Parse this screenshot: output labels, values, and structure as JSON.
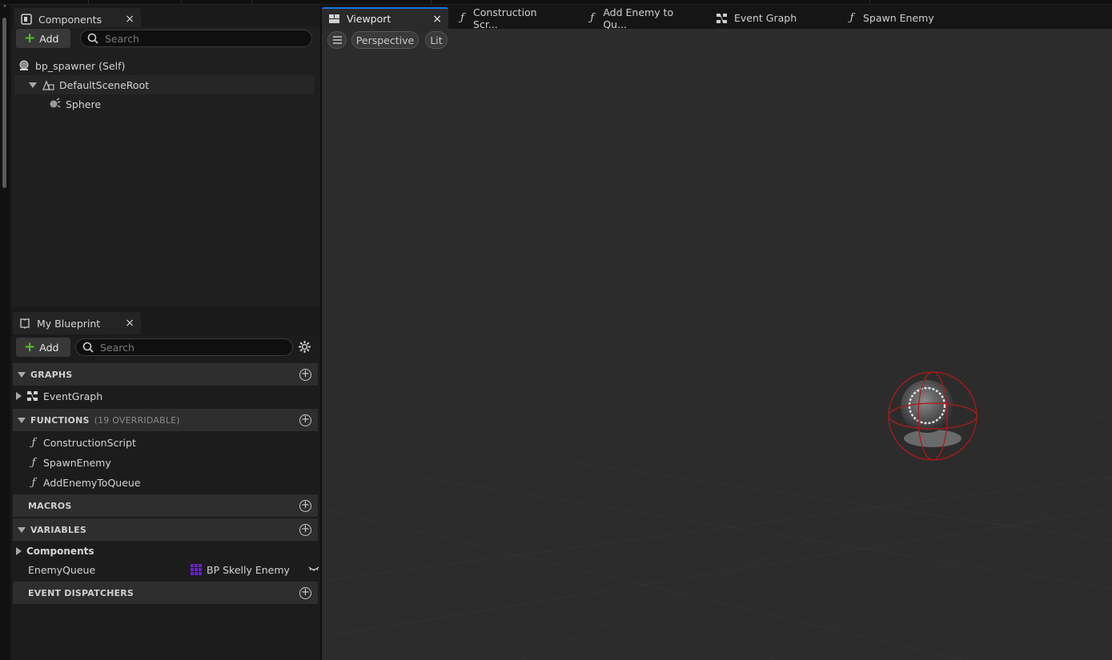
{
  "components_panel": {
    "tab_label": "Components",
    "close_glyph": "×",
    "add_label": "Add",
    "search_placeholder": "Search",
    "tree": [
      {
        "label": "bp_spawner (Self)",
        "icon": "blueprint-self-icon"
      },
      {
        "label": "DefaultSceneRoot",
        "icon": "scene-root-icon"
      },
      {
        "label": "Sphere",
        "icon": "sphere-icon"
      }
    ]
  },
  "my_blueprint_panel": {
    "tab_label": "My Blueprint",
    "close_glyph": "×",
    "add_label": "Add",
    "search_placeholder": "Search",
    "sections": {
      "graphs": {
        "title": "GRAPHS",
        "items": [
          "EventGraph"
        ]
      },
      "functions": {
        "title": "FUNCTIONS",
        "subtitle": "(19 OVERRIDABLE)",
        "items": [
          "ConstructionScript",
          "SpawnEnemy",
          "AddEnemyToQueue"
        ]
      },
      "macros": {
        "title": "MACROS"
      },
      "variables": {
        "title": "VARIABLES",
        "category": "Components",
        "items": [
          {
            "name": "EnemyQueue",
            "type": "BP Skelly Enemy",
            "type_color": "#6a1fd0"
          }
        ]
      },
      "event_dispatchers": {
        "title": "EVENT DISPATCHERS"
      }
    }
  },
  "document_tabs": [
    {
      "label": "Viewport",
      "icon": "viewport-icon",
      "active": true
    },
    {
      "label": "Construction Scr...",
      "icon": "function-icon"
    },
    {
      "label": "Add Enemy to Qu...",
      "icon": "function-icon"
    },
    {
      "label": "Event Graph",
      "icon": "event-graph-icon"
    },
    {
      "label": "Spawn Enemy",
      "icon": "function-icon"
    }
  ],
  "viewport": {
    "view_mode": "Perspective",
    "lighting_mode": "Lit"
  },
  "colors": {
    "accent": "#1a73e8",
    "add_green": "#55c02b",
    "selection_red": "#b01818"
  }
}
